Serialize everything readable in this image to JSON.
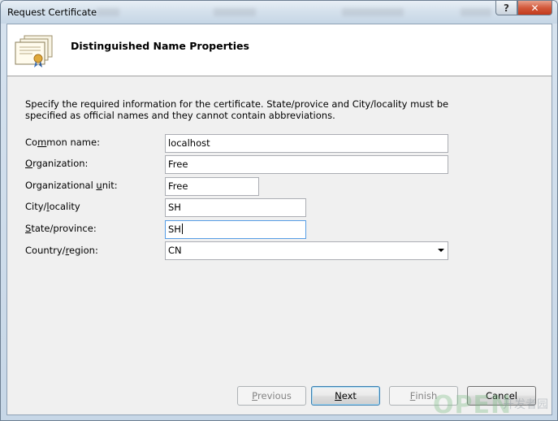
{
  "window": {
    "title": "Request Certificate",
    "help_glyph": "?",
    "close_glyph": "✕"
  },
  "header": {
    "title": "Distinguished Name Properties",
    "icon": "certificate-icon"
  },
  "description": "Specify the required information for the certificate. State/provice and City/locality must be specified as official names and they cannot contain abbreviations.",
  "fields": {
    "common_name": {
      "label_pre": "Co",
      "label_key": "m",
      "label_post": "mon name:",
      "value": "localhost"
    },
    "organization": {
      "label_pre": "",
      "label_key": "O",
      "label_post": "rganization:",
      "value": "Free"
    },
    "org_unit": {
      "label_pre": "Organizational ",
      "label_key": "u",
      "label_post": "nit:",
      "value": "Free"
    },
    "city": {
      "label_pre": "City/",
      "label_key": "l",
      "label_post": "ocality",
      "value": "SH"
    },
    "state": {
      "label_pre": "",
      "label_key": "S",
      "label_post": "tate/province:",
      "value": "SH"
    },
    "country": {
      "label_pre": "Country/",
      "label_key": "r",
      "label_post": "egion:",
      "value": "CN"
    }
  },
  "buttons": {
    "previous": {
      "key": "P",
      "rest": "revious"
    },
    "next": {
      "key": "N",
      "rest": "ext"
    },
    "finish": {
      "key": "F",
      "rest": "inish"
    },
    "cancel": "Cancel"
  },
  "watermark": {
    "main": "OPEN",
    "sub": "开发者园"
  }
}
